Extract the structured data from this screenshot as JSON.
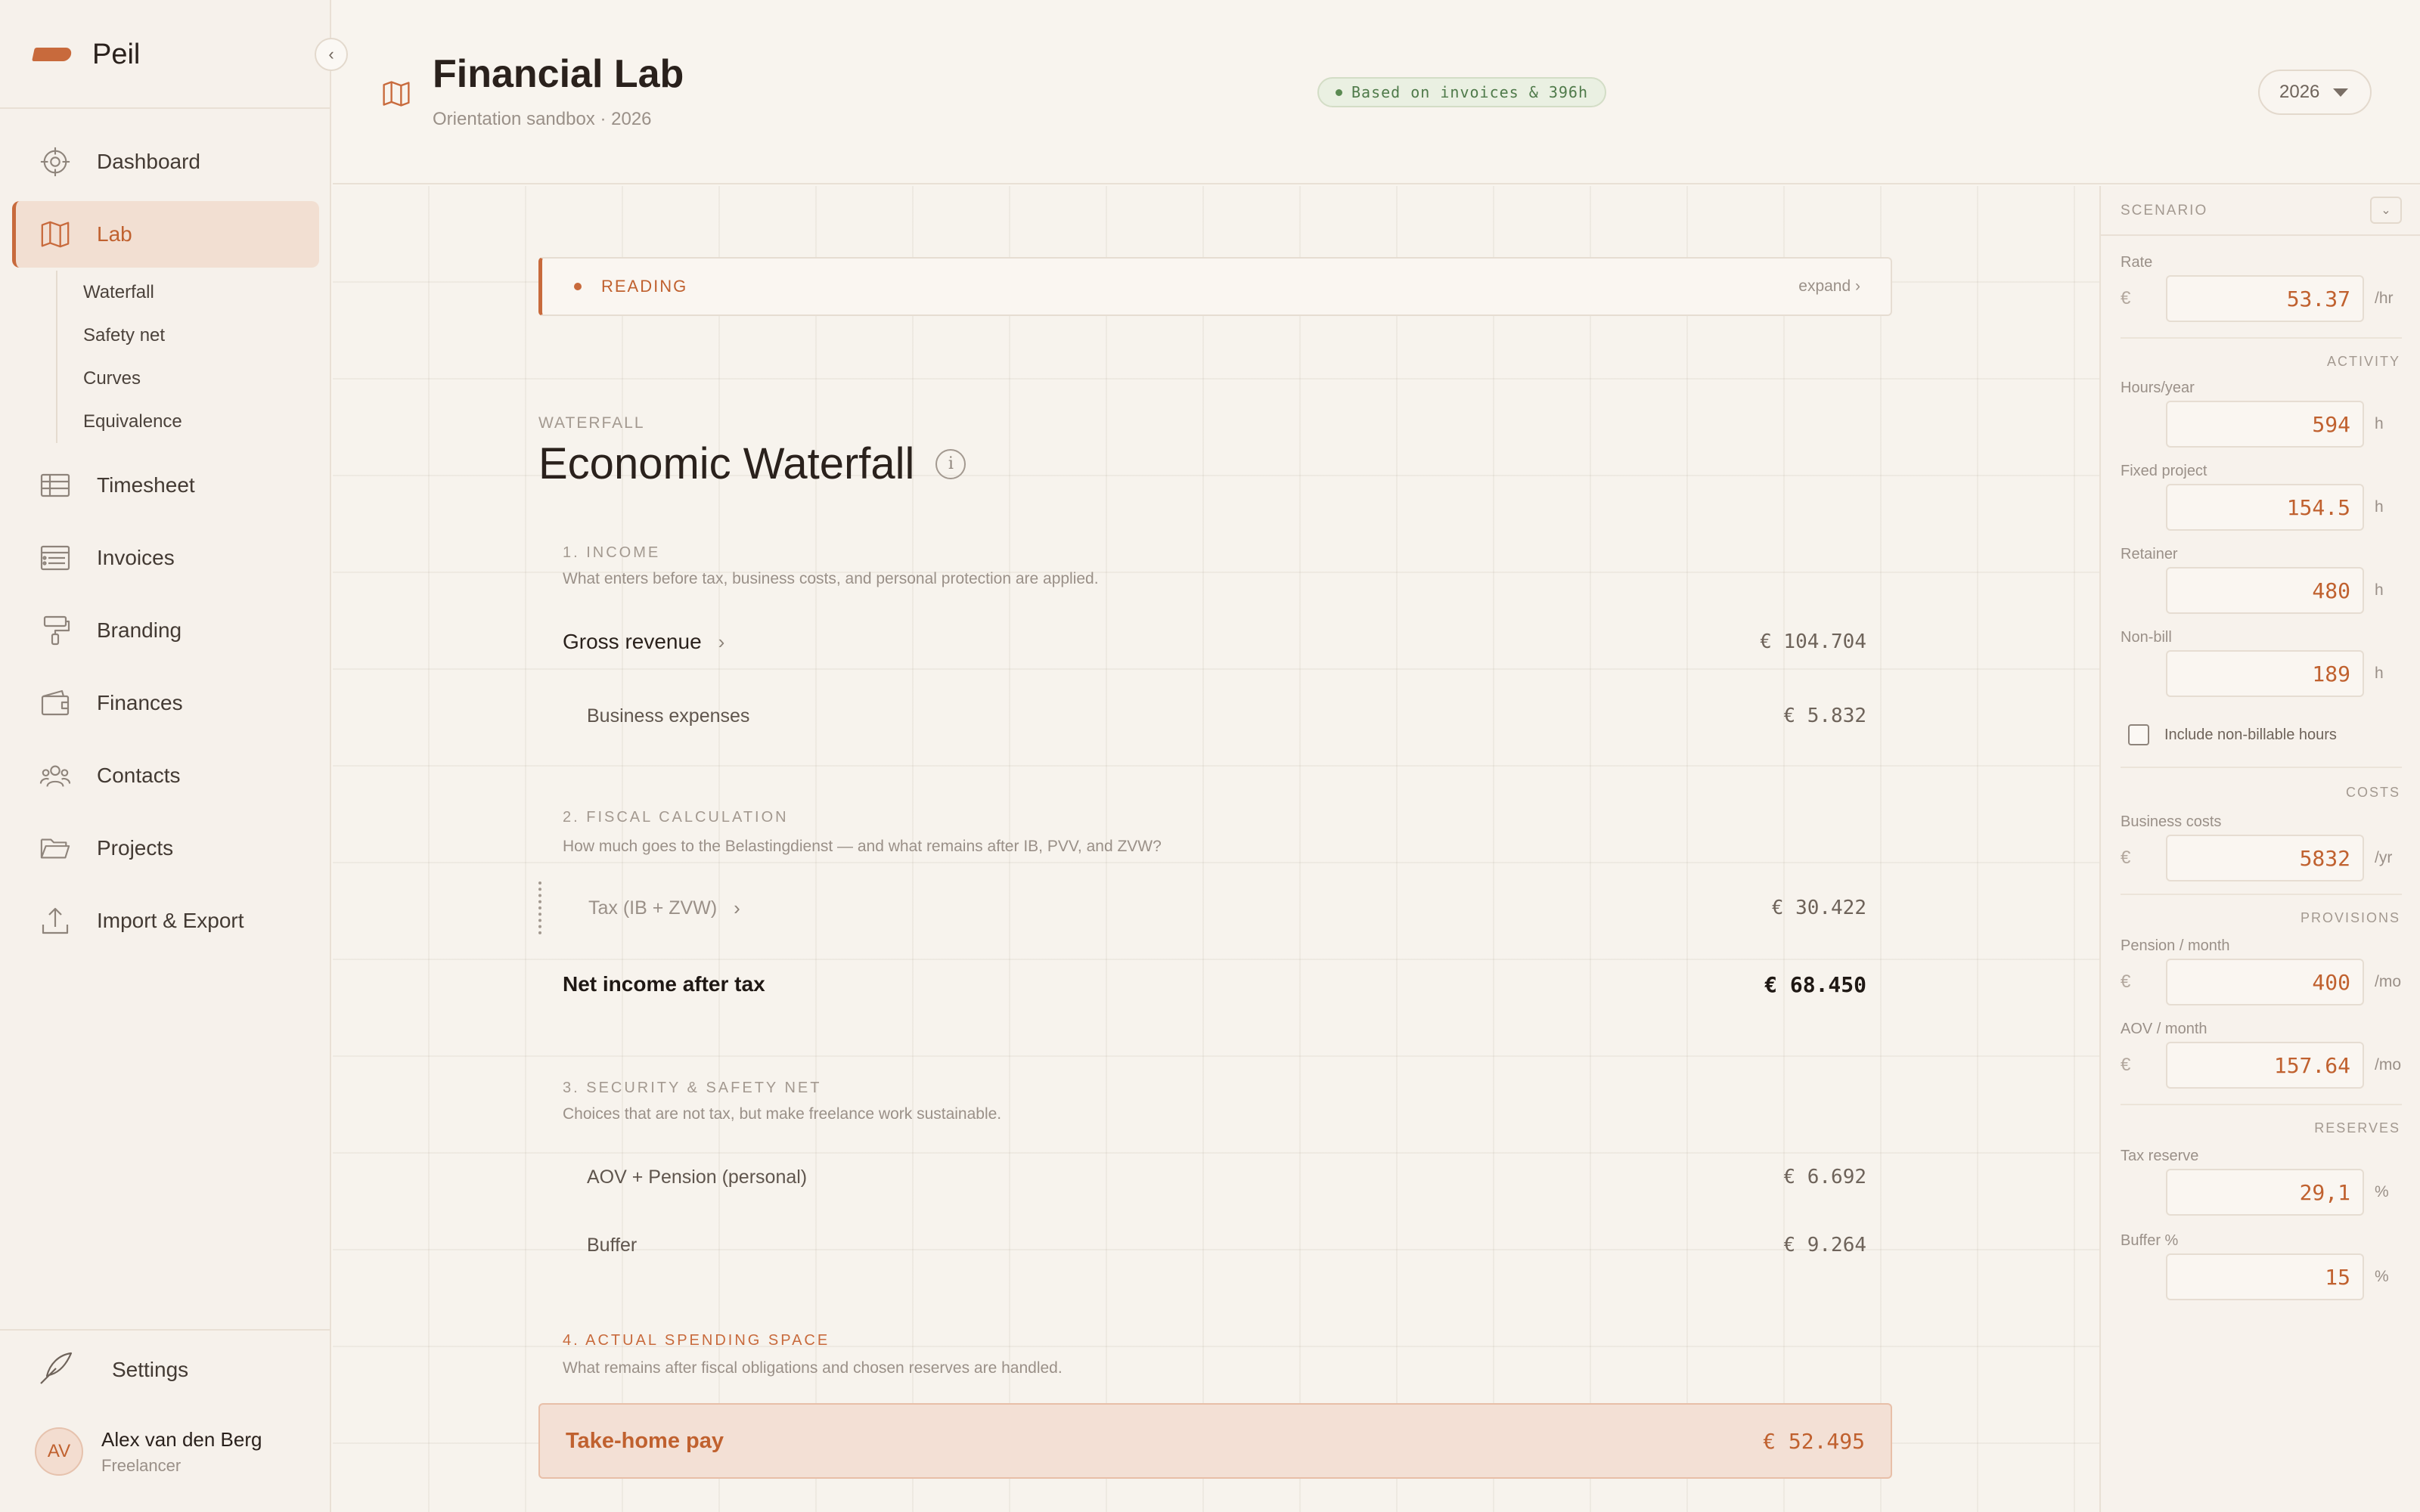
{
  "brand": {
    "name": "Peil"
  },
  "sidebar": {
    "items": [
      {
        "label": "Dashboard",
        "icon": "crosshair-icon"
      },
      {
        "label": "Lab",
        "icon": "map-icon"
      },
      {
        "label": "Timesheet",
        "icon": "table-icon"
      },
      {
        "label": "Invoices",
        "icon": "invoice-table-icon"
      },
      {
        "label": "Branding",
        "icon": "paint-roller-icon"
      },
      {
        "label": "Finances",
        "icon": "wallet-icon"
      },
      {
        "label": "Contacts",
        "icon": "people-icon"
      },
      {
        "label": "Projects",
        "icon": "folder-icon"
      },
      {
        "label": "Import & Export",
        "icon": "upload-icon"
      }
    ],
    "lab_subitems": [
      "Waterfall",
      "Safety net",
      "Curves",
      "Equivalence"
    ],
    "settings_label": "Settings",
    "user": {
      "initials": "AV",
      "name": "Alex van den Berg",
      "role": "Freelancer"
    }
  },
  "header": {
    "title": "Financial Lab",
    "subtitle": "Orientation sandbox · 2026",
    "badge": "Based on invoices & 396h",
    "year": "2026"
  },
  "reading": {
    "label": "READING",
    "expand": "expand ›"
  },
  "waterfall": {
    "eyebrow": "WATERFALL",
    "title": "Economic Waterfall",
    "info": "i",
    "sections": [
      {
        "head": "1. INCOME",
        "desc": "What enters before tax, business costs, and personal protection are applied."
      },
      {
        "head": "2. FISCAL CALCULATION",
        "desc": "How much goes to the Belastingdienst — and what remains after IB, PVV, and ZVW?"
      },
      {
        "head": "3. SECURITY & SAFETY NET",
        "desc": "Choices that are not tax, but make freelance work sustainable."
      },
      {
        "head": "4. ACTUAL SPENDING SPACE",
        "desc": "What remains after fiscal obligations and chosen reserves are handled."
      }
    ],
    "rows": {
      "gross": {
        "label": "Gross revenue",
        "value": "€ 104.704"
      },
      "expenses": {
        "label": "Business expenses",
        "value": "€ 5.832"
      },
      "tax": {
        "label": "Tax (IB + ZVW)",
        "value": "€ 30.422"
      },
      "net": {
        "label": "Net income after tax",
        "value": "€ 68.450"
      },
      "aov": {
        "label": "AOV + Pension (personal)",
        "value": "€ 6.692"
      },
      "buffer": {
        "label": "Buffer",
        "value": "€ 9.264"
      },
      "takehome": {
        "label": "Take-home pay",
        "value": "€ 52.495"
      }
    }
  },
  "scenario": {
    "title": "SCENARIO",
    "groups": {
      "activity": "ACTIVITY",
      "costs": "COSTS",
      "provisions": "PROVISIONS",
      "reserves": "RESERVES"
    },
    "fields": {
      "rate": {
        "label": "Rate",
        "currency": "€",
        "value": "53.37",
        "unit": "/hr"
      },
      "hours": {
        "label": "Hours/year",
        "value": "594",
        "unit": "h"
      },
      "fixed": {
        "label": "Fixed project",
        "value": "154.5",
        "unit": "h"
      },
      "retainer": {
        "label": "Retainer",
        "value": "480",
        "unit": "h"
      },
      "nonbill": {
        "label": "Non-bill",
        "value": "189",
        "unit": "h"
      },
      "business_costs": {
        "label": "Business costs",
        "currency": "€",
        "value": "5832",
        "unit": "/yr"
      },
      "pension": {
        "label": "Pension / month",
        "currency": "€",
        "value": "400",
        "unit": "/mo"
      },
      "aov": {
        "label": "AOV / month",
        "currency": "€",
        "value": "157.64",
        "unit": "/mo"
      },
      "tax_reserve": {
        "label": "Tax reserve",
        "value": "29,1",
        "unit": "%"
      },
      "buffer": {
        "label": "Buffer %",
        "value": "15",
        "unit": "%"
      }
    },
    "include_nonbill": {
      "label": "Include non-billable hours",
      "checked": false
    }
  },
  "colors": {
    "accent": "#c86a3c",
    "badge_green": "#4f7a4a",
    "background": "#f8f4ee"
  }
}
